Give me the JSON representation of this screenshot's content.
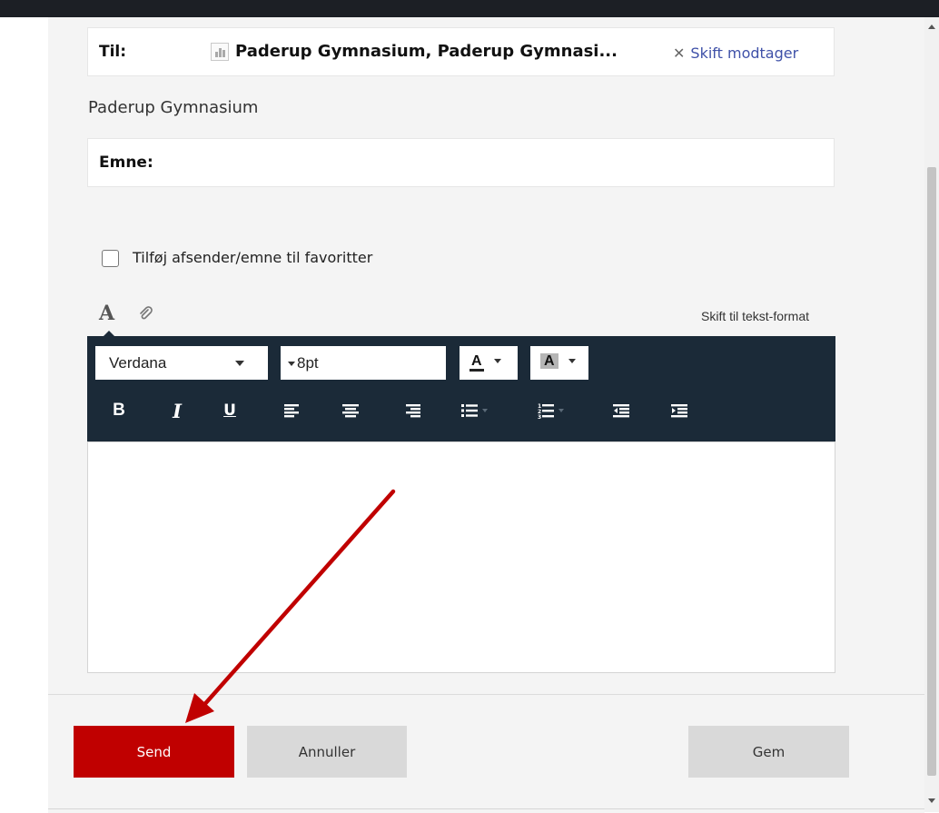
{
  "message": {
    "to_label": "Til:",
    "recipient": "Paderup Gymnasium, Paderup Gymnasi...",
    "change_recipient": "Skift modtager",
    "recipient_subtitle": "Paderup Gymnasium",
    "subject_label": "Emne:",
    "favorite_label": "Tilføj afsender/emne til favoritter",
    "favorite_checked": false
  },
  "editor": {
    "text_format_link": "Skift til tekst-format",
    "font_family": "Verdana",
    "font_size": "8pt",
    "font_color_label": "A",
    "background_color_label": "A",
    "bold_label": "B",
    "italic_label": "I",
    "underline_label": "U",
    "toolbar_icons": [
      "align-left-icon",
      "align-center-icon",
      "align-right-icon",
      "bullet-list-icon",
      "numbered-list-icon",
      "outdent-icon",
      "indent-icon"
    ]
  },
  "actions": {
    "send": "Send",
    "cancel": "Annuller",
    "save": "Gem"
  },
  "colors": {
    "send_button": "#c00000",
    "toolbar_background": "#1b2a38",
    "annotation_arrow": "#c00000",
    "link": "#3f51a8"
  }
}
